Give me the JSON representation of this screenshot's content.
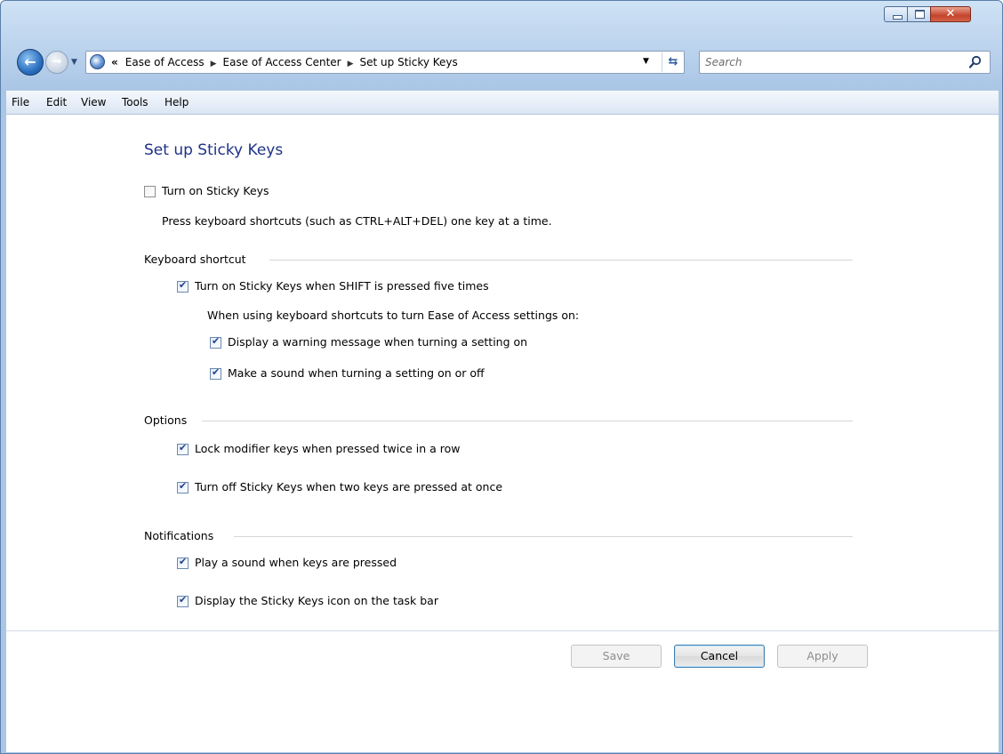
{
  "window": {
    "controls": {
      "minimize": "–",
      "maximize": "□",
      "close": "✕"
    }
  },
  "nav": {
    "back_glyph": "←",
    "forward_glyph": "→",
    "address": {
      "overflow": "«",
      "crumbs": [
        "Ease of Access",
        "Ease of Access Center",
        "Set up Sticky Keys"
      ],
      "separator": "▶",
      "dropdown_glyph": "▼",
      "refresh_glyph": "⇆"
    },
    "search": {
      "placeholder": "Search"
    }
  },
  "menu": {
    "items": [
      "File",
      "Edit",
      "View",
      "Tools",
      "Help"
    ]
  },
  "page": {
    "title": "Set up Sticky Keys",
    "main_option": {
      "label": "Turn on Sticky Keys",
      "checked": false
    },
    "main_description": "Press keyboard shortcuts (such as CTRL+ALT+DEL) one key at a time.",
    "sections": {
      "keyboard_shortcut": {
        "heading": "Keyboard shortcut",
        "shift_option": {
          "label": "Turn on Sticky Keys when SHIFT is pressed five times",
          "checked": true
        },
        "subheading": "When using keyboard shortcuts to turn Ease of Access settings on:",
        "warning_option": {
          "label": "Display a warning message when turning a setting on",
          "checked": true
        },
        "sound_option": {
          "label": "Make a sound when turning a setting on or off",
          "checked": true
        }
      },
      "options": {
        "heading": "Options",
        "lock_option": {
          "label": "Lock modifier keys when pressed twice in a row",
          "checked": true
        },
        "turnoff_option": {
          "label": "Turn off Sticky Keys when two keys are pressed at once",
          "checked": true
        }
      },
      "notifications": {
        "heading": "Notifications",
        "sound_option": {
          "label": "Play a sound when keys are pressed",
          "checked": true
        },
        "icon_option": {
          "label": "Display the Sticky Keys icon on the task bar",
          "checked": true
        }
      }
    }
  },
  "buttons": {
    "save": "Save",
    "cancel": "Cancel",
    "apply": "Apply"
  }
}
